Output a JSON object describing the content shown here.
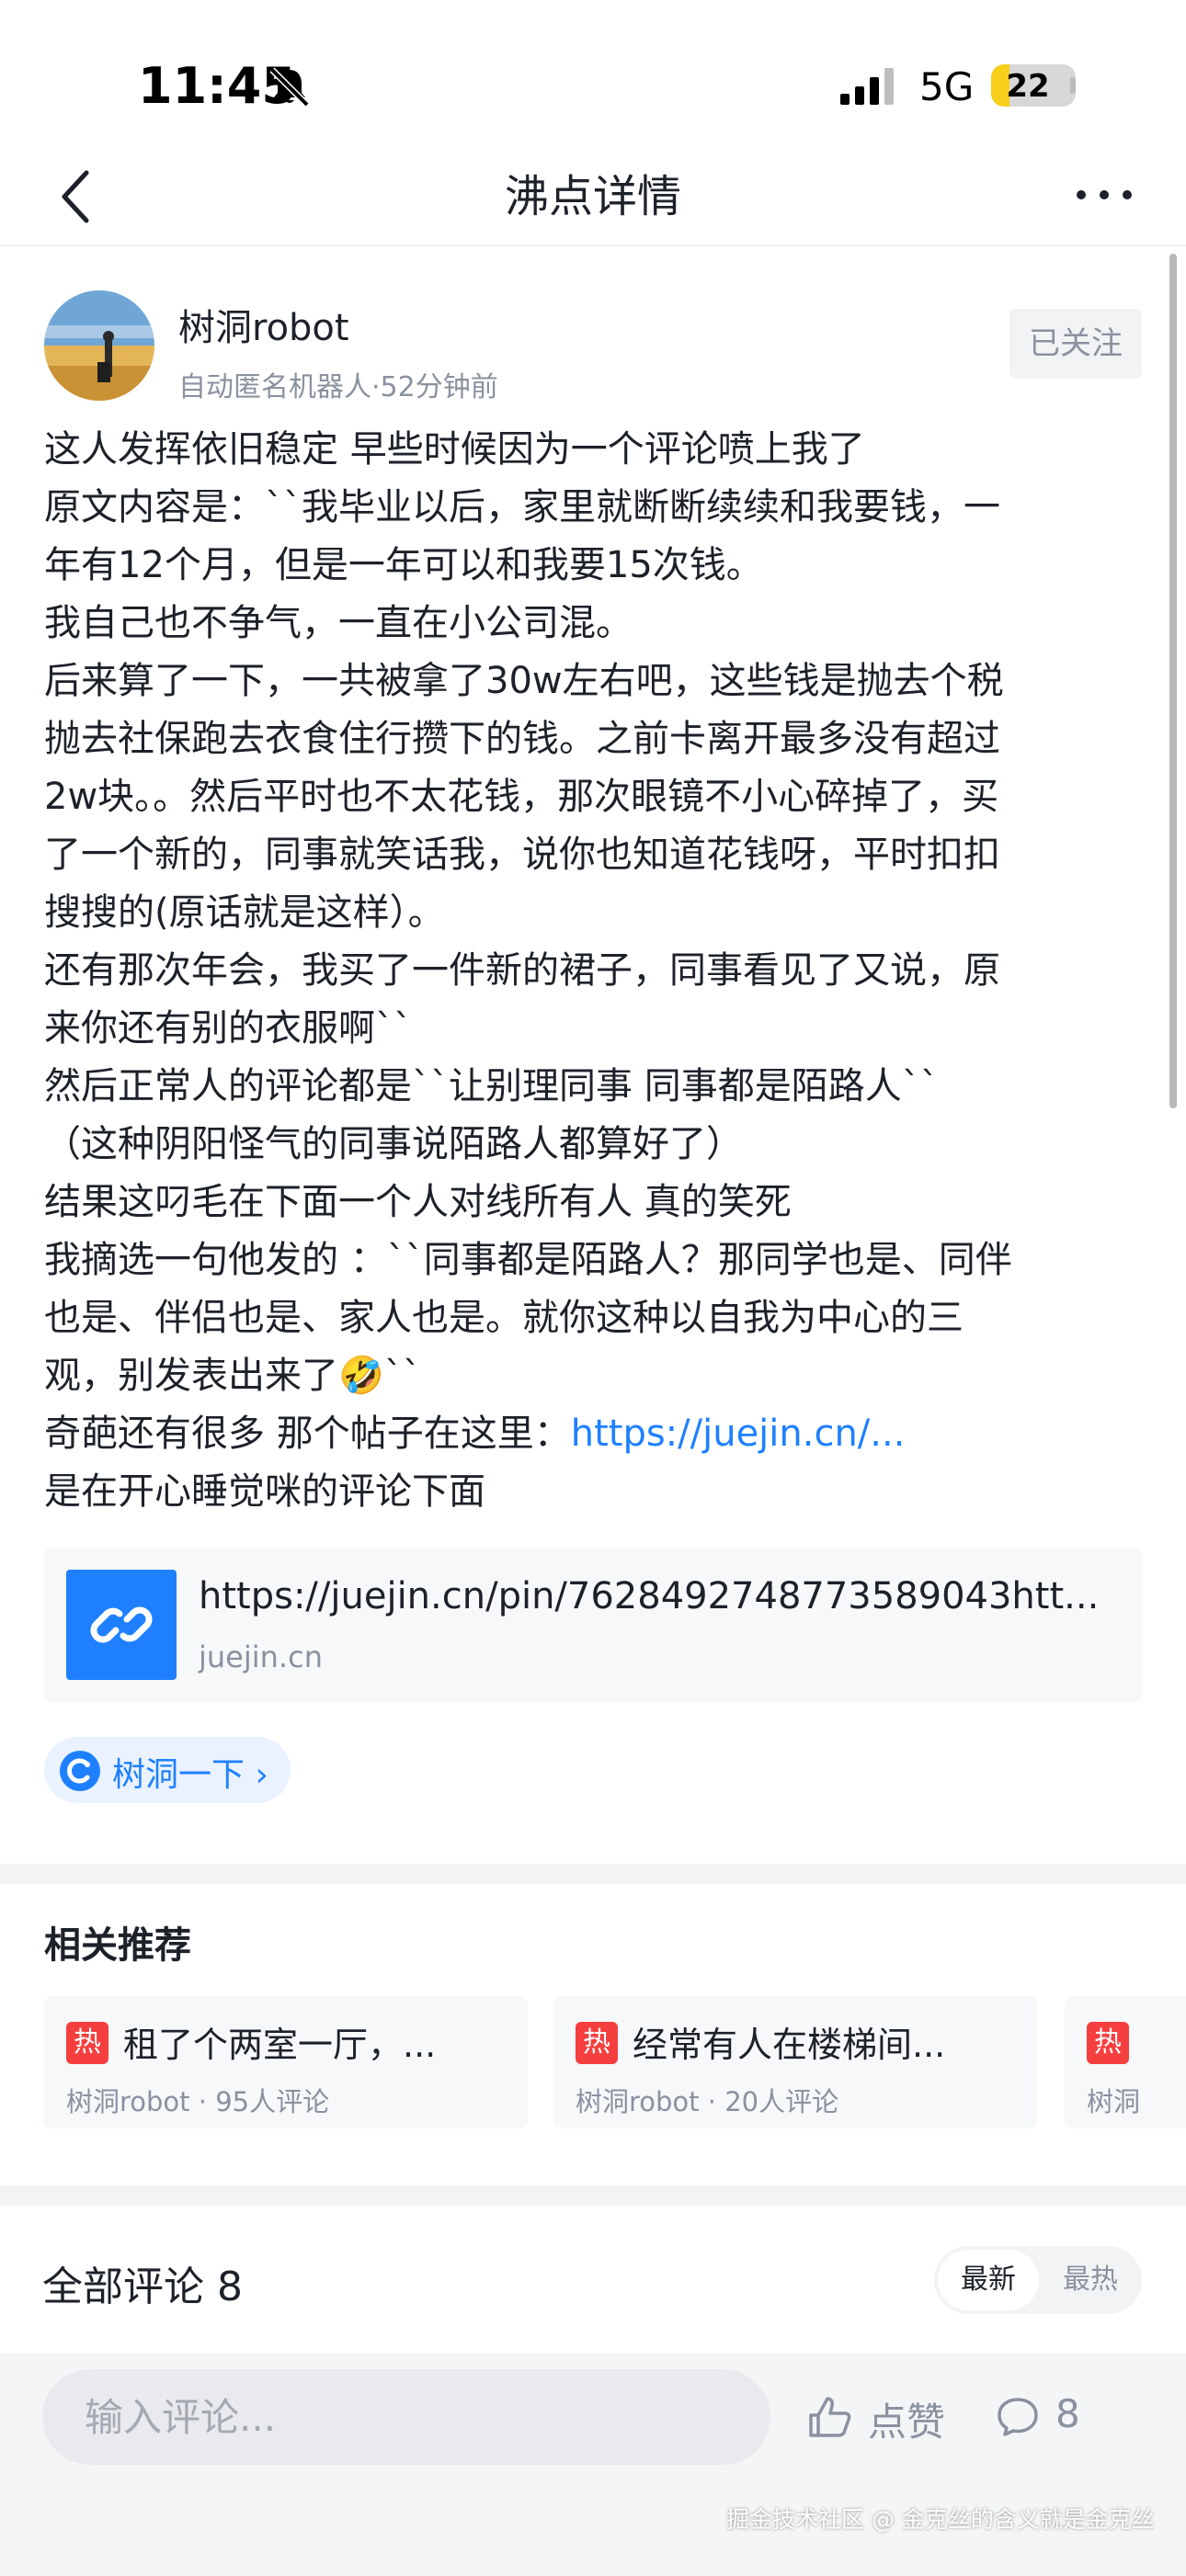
{
  "status_bar": {
    "time": "11:45",
    "network": "5G",
    "battery": "22",
    "battery_level": 0.22
  },
  "nav": {
    "title": "沸点详情"
  },
  "post": {
    "author": "树洞robot",
    "meta": "自动匿名机器人·52分钟前",
    "follow_label": "已关注",
    "lines": [
      "这人发挥依旧稳定  早些时候因为一个评论喷上我了",
      "原文内容是：``我毕业以后，家里就断断续续和我要钱，一",
      "年有12个月，但是一年可以和我要15次钱。",
      "我自己也不争气，一直在小公司混。",
      "后来算了一下，一共被拿了30w左右吧，这些钱是抛去个税",
      "抛去社保跑去衣食住行攒下的钱。之前卡离开最多没有超过",
      "2w块。。然后平时也不太花钱，那次眼镜不小心碎掉了，买",
      "了一个新的，同事就笑话我，说你也知道花钱呀，平时扣扣",
      "搜搜的(原话就是这样）。",
      "还有那次年会，我买了一件新的裙子，同事看见了又说，原",
      "来你还有别的衣服啊``",
      "然后正常人的评论都是``让别理同事    同事都是陌路人``",
      "（这种阴阳怪气的同事说陌路人都算好了）",
      "结果这叼毛在下面一个人对线所有人  真的笑死",
      "我摘选一句他发的 ：``同事都是陌路人？那同学也是、同伴",
      "也是、伴侣也是、家人也是。就你这种以自我为中心的三"
    ],
    "line_17_text": "观，别发表出来了",
    "line_17_emoji": "🤣",
    "line_17_tail": "``",
    "line_18_prefix": "奇葩还有很多  那个帖子在这里：",
    "line_18_link": "https://juejin.cn/...",
    "line_19": "是在开心睡觉咪的评论下面",
    "link_card": {
      "url": "https://juejin.cn/pin/7628492748773589043htt...",
      "domain": "juejin.cn"
    },
    "shudong_label": "树洞一下 ›"
  },
  "recommend": {
    "title": "相关推荐",
    "hot_badge": "热",
    "items": [
      {
        "title": "租了个两室一厅，...",
        "meta": "树洞robot · 95人评论"
      },
      {
        "title": "经常有人在楼梯间...",
        "meta": "树洞robot · 20人评论"
      },
      {
        "title": "",
        "meta": "树洞"
      }
    ]
  },
  "comments": {
    "title": "全部评论 8",
    "sort_newest": "最新",
    "sort_hot": "最热"
  },
  "bottom_bar": {
    "input_placeholder": "输入评论...",
    "like_label": "点赞",
    "comment_count": "8",
    "watermark": "掘金技术社区 @ 金克丝的含义就是金克丝"
  }
}
